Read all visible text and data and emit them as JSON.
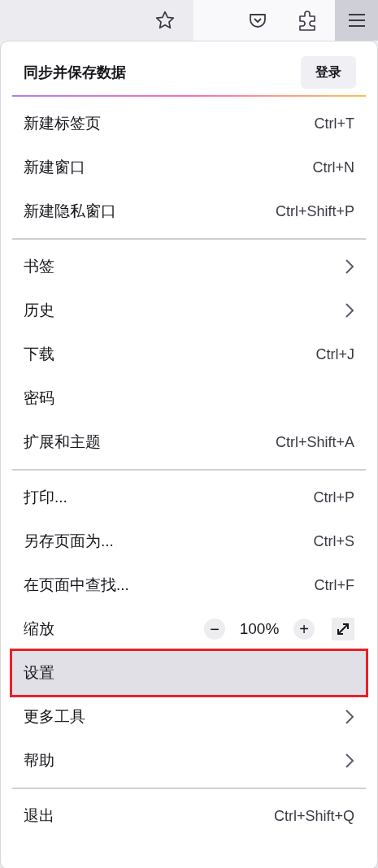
{
  "toolbar": {
    "menu_open": true
  },
  "menu": {
    "header": {
      "title": "同步并保存数据",
      "button": "登录"
    },
    "sections": [
      {
        "items": [
          {
            "kind": "item",
            "label": "新建标签页",
            "shortcut": "Ctrl+T",
            "submenu": false,
            "highlighted": false
          },
          {
            "kind": "item",
            "label": "新建窗口",
            "shortcut": "Ctrl+N",
            "submenu": false,
            "highlighted": false
          },
          {
            "kind": "item",
            "label": "新建隐私窗口",
            "shortcut": "Ctrl+Shift+P",
            "submenu": false,
            "highlighted": false
          }
        ]
      },
      {
        "items": [
          {
            "kind": "item",
            "label": "书签",
            "submenu": true,
            "highlighted": false
          },
          {
            "kind": "item",
            "label": "历史",
            "submenu": true,
            "highlighted": false
          },
          {
            "kind": "item",
            "label": "下载",
            "shortcut": "Ctrl+J",
            "submenu": false,
            "highlighted": false
          },
          {
            "kind": "item",
            "label": "密码",
            "submenu": false,
            "highlighted": false
          },
          {
            "kind": "item",
            "label": "扩展和主题",
            "shortcut": "Ctrl+Shift+A",
            "submenu": false,
            "highlighted": false
          }
        ]
      },
      {
        "items": [
          {
            "kind": "item",
            "label": "打印...",
            "shortcut": "Ctrl+P",
            "submenu": false,
            "highlighted": false
          },
          {
            "kind": "item",
            "label": "另存页面为...",
            "shortcut": "Ctrl+S",
            "submenu": false,
            "highlighted": false
          },
          {
            "kind": "item",
            "label": "在页面中查找...",
            "shortcut": "Ctrl+F",
            "submenu": false,
            "highlighted": false
          },
          {
            "kind": "zoom",
            "label": "缩放",
            "minus": "−",
            "value": "100%",
            "plus": "+"
          },
          {
            "kind": "item",
            "label": "设置",
            "submenu": false,
            "highlighted": true
          },
          {
            "kind": "item",
            "label": "更多工具",
            "submenu": true,
            "highlighted": false
          },
          {
            "kind": "item",
            "label": "帮助",
            "submenu": true,
            "highlighted": false
          }
        ]
      },
      {
        "items": [
          {
            "kind": "item",
            "label": "退出",
            "shortcut": "Ctrl+Shift+Q",
            "submenu": false,
            "highlighted": false
          }
        ]
      }
    ]
  }
}
